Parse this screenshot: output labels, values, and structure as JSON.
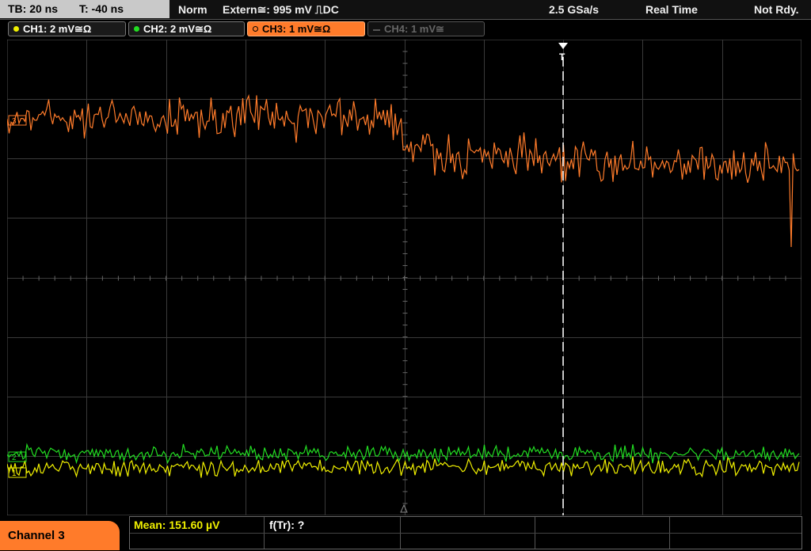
{
  "topbar": {
    "timebase": "TB: 20 ns",
    "trigger_time": "T: -40 ns",
    "acq_mode": "Norm",
    "trigger_source": "Extern≅: 995 mV ⎍DC",
    "sample_rate": "2.5 GSa/s",
    "realtime": "Real Time",
    "status": "Not Rdy."
  },
  "channels": [
    {
      "label": "CH1: 2 mV≅Ω",
      "color": "#f0f000",
      "active": true
    },
    {
      "label": "CH2: 2 mV≅Ω",
      "color": "#22dd22",
      "active": true
    },
    {
      "label": "CH3: 1 mV≅Ω",
      "color": "#ff7b2a",
      "active": true,
      "selected": true
    },
    {
      "label": "CH4: 1 mV≅",
      "color": "#555555",
      "active": false
    }
  ],
  "footer": {
    "channel_tab": "Channel 3",
    "mean": "Mean: 151.60 µV",
    "freq": "f(Tr): ?"
  },
  "colors": {
    "ch1": "#f0f000",
    "ch2": "#22dd22",
    "ch3": "#ff7b2a",
    "grid": "#3a3a3a"
  }
}
